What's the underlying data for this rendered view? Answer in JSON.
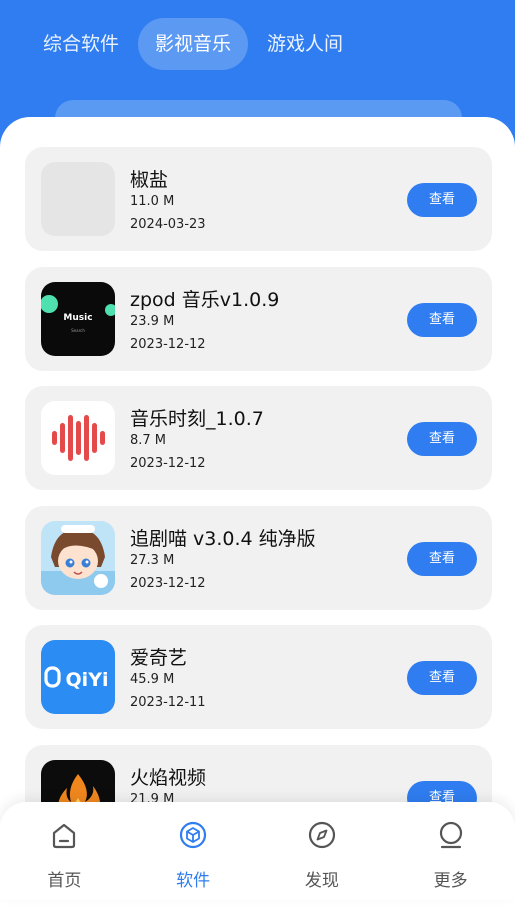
{
  "colors": {
    "accent": "#2f7df0",
    "card_bg": "#f1f1f1",
    "nav_inactive": "#555555"
  },
  "tabs": [
    {
      "label": "综合软件",
      "active": false
    },
    {
      "label": "影视音乐",
      "active": true
    },
    {
      "label": "游戏人间",
      "active": false
    }
  ],
  "apps": [
    {
      "name": "椒盐",
      "size": "11.0 M",
      "date": "2024-03-23",
      "button": "查看",
      "icon": "placeholder-icon"
    },
    {
      "name": "zpod 音乐v1.0.9",
      "size": "23.9 M",
      "date": "2023-12-12",
      "button": "查看",
      "icon": "music-app-icon",
      "icon_text": "Music",
      "icon_subtext": "Search"
    },
    {
      "name": "音乐时刻_1.0.7",
      "size": "8.7 M",
      "date": "2023-12-12",
      "button": "查看",
      "icon": "sound-wave-icon"
    },
    {
      "name": "追剧喵 v3.0.4 纯净版",
      "size": "27.3 M",
      "date": "2023-12-12",
      "button": "查看",
      "icon": "anime-character-icon"
    },
    {
      "name": "爱奇艺",
      "size": "45.9 M",
      "date": "2023-12-11",
      "button": "查看",
      "icon": "iqiyi-logo-icon",
      "icon_text": "QiYi"
    },
    {
      "name": "火焰视频",
      "size": "21.9 M",
      "date": "",
      "button": "查看",
      "icon": "flame-icon"
    }
  ],
  "nav": [
    {
      "label": "首页",
      "icon": "home-icon",
      "active": false
    },
    {
      "label": "软件",
      "icon": "cube-icon",
      "active": true
    },
    {
      "label": "发现",
      "icon": "compass-icon",
      "active": false
    },
    {
      "label": "更多",
      "icon": "user-icon",
      "active": false
    }
  ]
}
